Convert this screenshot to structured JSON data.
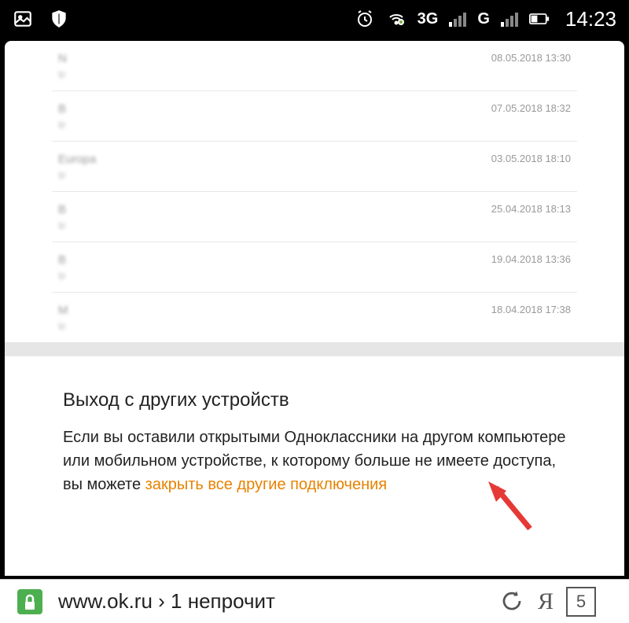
{
  "status_bar": {
    "time": "14:23",
    "network_3g": "3G",
    "network_g": "G"
  },
  "sessions": [
    {
      "name": "N",
      "date": "08.05.2018 13:30"
    },
    {
      "name": "B",
      "date": "07.05.2018 18:32"
    },
    {
      "name": "Europa",
      "date": "03.05.2018 18:10"
    },
    {
      "name": "B",
      "date": "25.04.2018 18:13"
    },
    {
      "name": "B",
      "date": "19.04.2018 13:36"
    },
    {
      "name": "M",
      "date": "18.04.2018 17:38"
    }
  ],
  "exit": {
    "title": "Выход с других устройств",
    "body_1": "Если вы оставили открытыми Одноклассники на другом компьютере или мобильном устройстве, к которому больше не имеете доступа, вы можете ",
    "link": "закрыть все другие подключения"
  },
  "browser": {
    "url": "www.ok.ru › 1 непрочит",
    "tabs_count": "5",
    "yandex": "Я"
  }
}
